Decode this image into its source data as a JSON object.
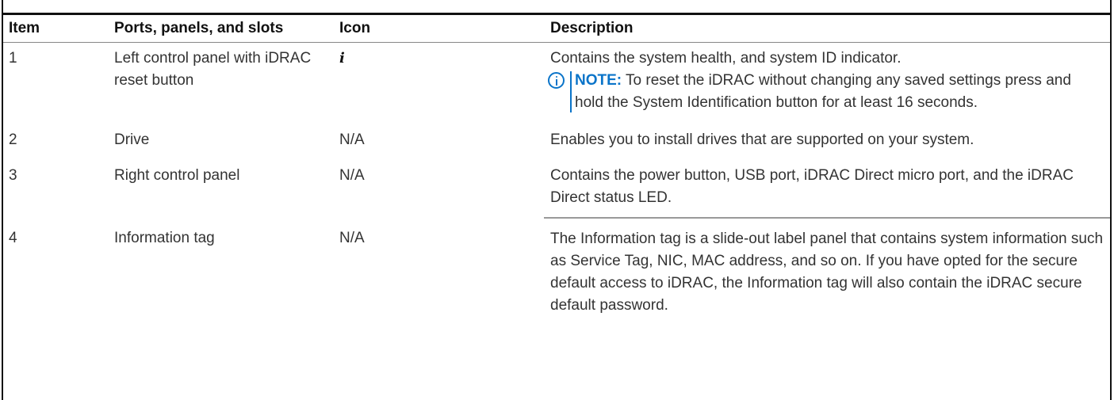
{
  "table": {
    "headers": [
      "Item",
      "Ports, panels, and slots",
      "Icon",
      "Description"
    ],
    "rows": [
      {
        "item": "1",
        "name": "Left control panel with iDRAC reset button",
        "icon": "i",
        "description": "Contains the system health, and system ID indicator.",
        "note_label": "NOTE:",
        "note_text": "To reset the iDRAC without changing any saved settings press and hold the System Identification button for at least 16 seconds."
      },
      {
        "item": "2",
        "name": "Drive",
        "icon": "N/A",
        "description": "Enables you to install drives that are supported on your system."
      },
      {
        "item": "3",
        "name": "Right control panel",
        "icon": "N/A",
        "description": "Contains the power button, USB port, iDRAC Direct micro port, and the iDRAC Direct status LED."
      },
      {
        "item": "4",
        "name": "Information tag",
        "icon": "N/A",
        "description": "The Information tag is a slide-out label panel that contains system information such as Service Tag, NIC, MAC address, and so on. If you have opted for the secure default access to iDRAC, the Information tag will also contain the iDRAC secure default password."
      }
    ]
  },
  "colors": {
    "note_accent": "#0a74c9",
    "rule": "#111111",
    "text": "#333333"
  },
  "icons": {
    "row1_icon": "info-i-icon",
    "note_icon": "info-circle-icon"
  }
}
